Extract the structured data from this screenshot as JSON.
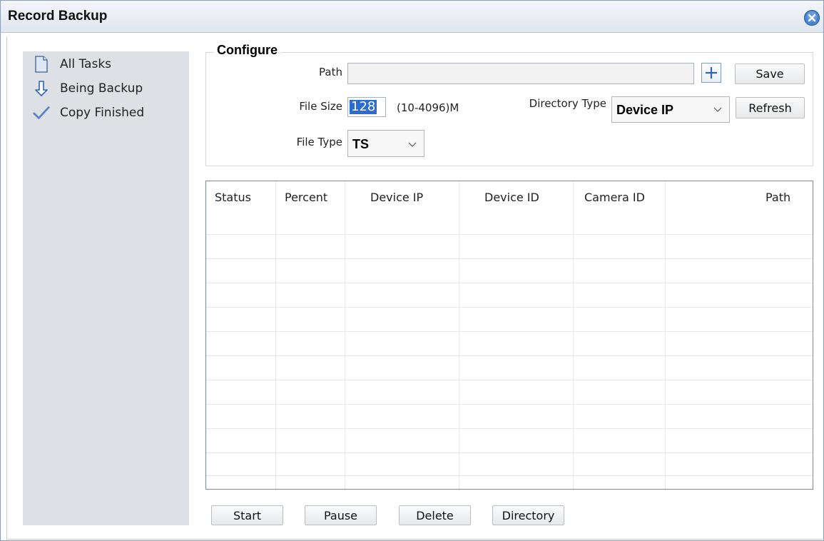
{
  "window": {
    "title": "Record Backup"
  },
  "sidebar": {
    "items": [
      {
        "label": "All Tasks",
        "icon": "document-icon"
      },
      {
        "label": "Being Backup",
        "icon": "download-arrow-icon"
      },
      {
        "label": "Copy Finished",
        "icon": "checkmark-icon"
      }
    ]
  },
  "configure": {
    "legend": "Configure",
    "path_label": "Path",
    "path_value": "",
    "add_icon": "plus-icon",
    "save_label": "Save",
    "file_size_label": "File Size",
    "file_size_value": "128",
    "file_size_range": "(10-4096)M",
    "directory_type_label": "Directory Type",
    "directory_type_value": "Device IP",
    "refresh_label": "Refresh",
    "file_type_label": "File Type",
    "file_type_value": "TS"
  },
  "table": {
    "columns": [
      "Status",
      "Percent",
      "Device IP",
      "Device ID",
      "Camera ID",
      "Path"
    ],
    "rows": []
  },
  "actions": {
    "start": "Start",
    "pause": "Pause",
    "delete": "Delete",
    "directory": "Directory"
  },
  "colors": {
    "accent": "#2c6bd1",
    "sidebar_bg": "#dde0e4",
    "close_button": "#3b78c9"
  }
}
